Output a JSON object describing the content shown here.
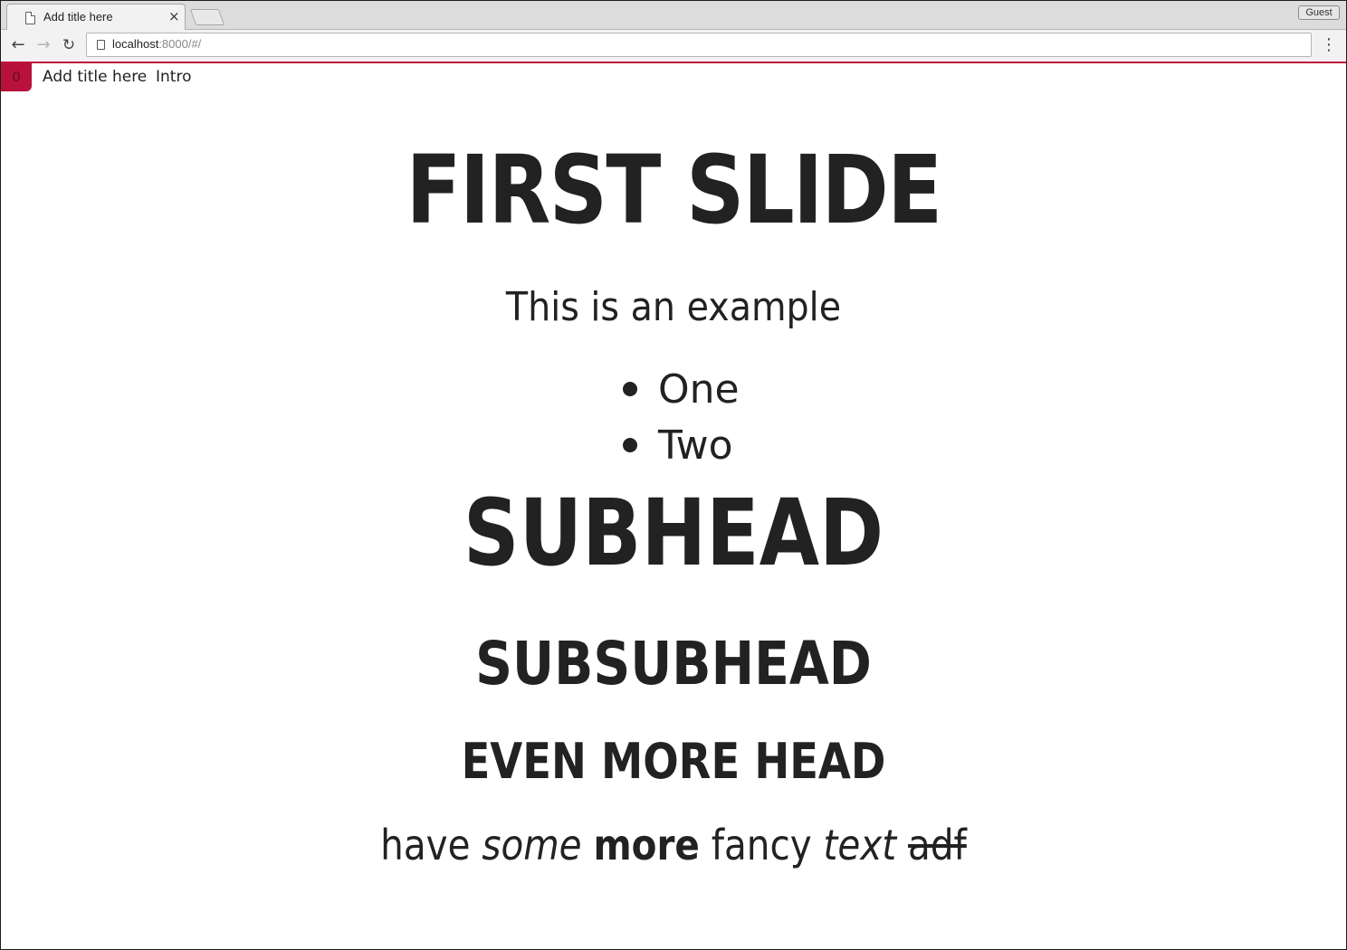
{
  "browser": {
    "tab_title": "Add title here",
    "tab_close": "×",
    "profile_label": "Guest",
    "url_host": "localhost",
    "url_rest": ":8000/#/",
    "back_glyph": "←",
    "forward_glyph": "→",
    "reload_glyph": "↻",
    "menu_glyph": "⋮"
  },
  "slide_nav": {
    "slide_number": "0",
    "items": [
      {
        "label": "Add title here"
      },
      {
        "label": "Intro"
      }
    ]
  },
  "slide": {
    "title": "FIRST SLIDE",
    "lead": "This is an example",
    "bullets": [
      "One",
      "Two"
    ],
    "subhead": "SUBHEAD",
    "subsubhead": "SUBSUBHEAD",
    "even_more_head": "EVEN MORE HEAD",
    "fancy": {
      "w1": "have",
      "w2": "some",
      "w3": "more",
      "w4": "fancy",
      "w5": "text",
      "w6": "adf"
    }
  },
  "colors": {
    "accent": "#c0103b",
    "text": "#222222"
  }
}
